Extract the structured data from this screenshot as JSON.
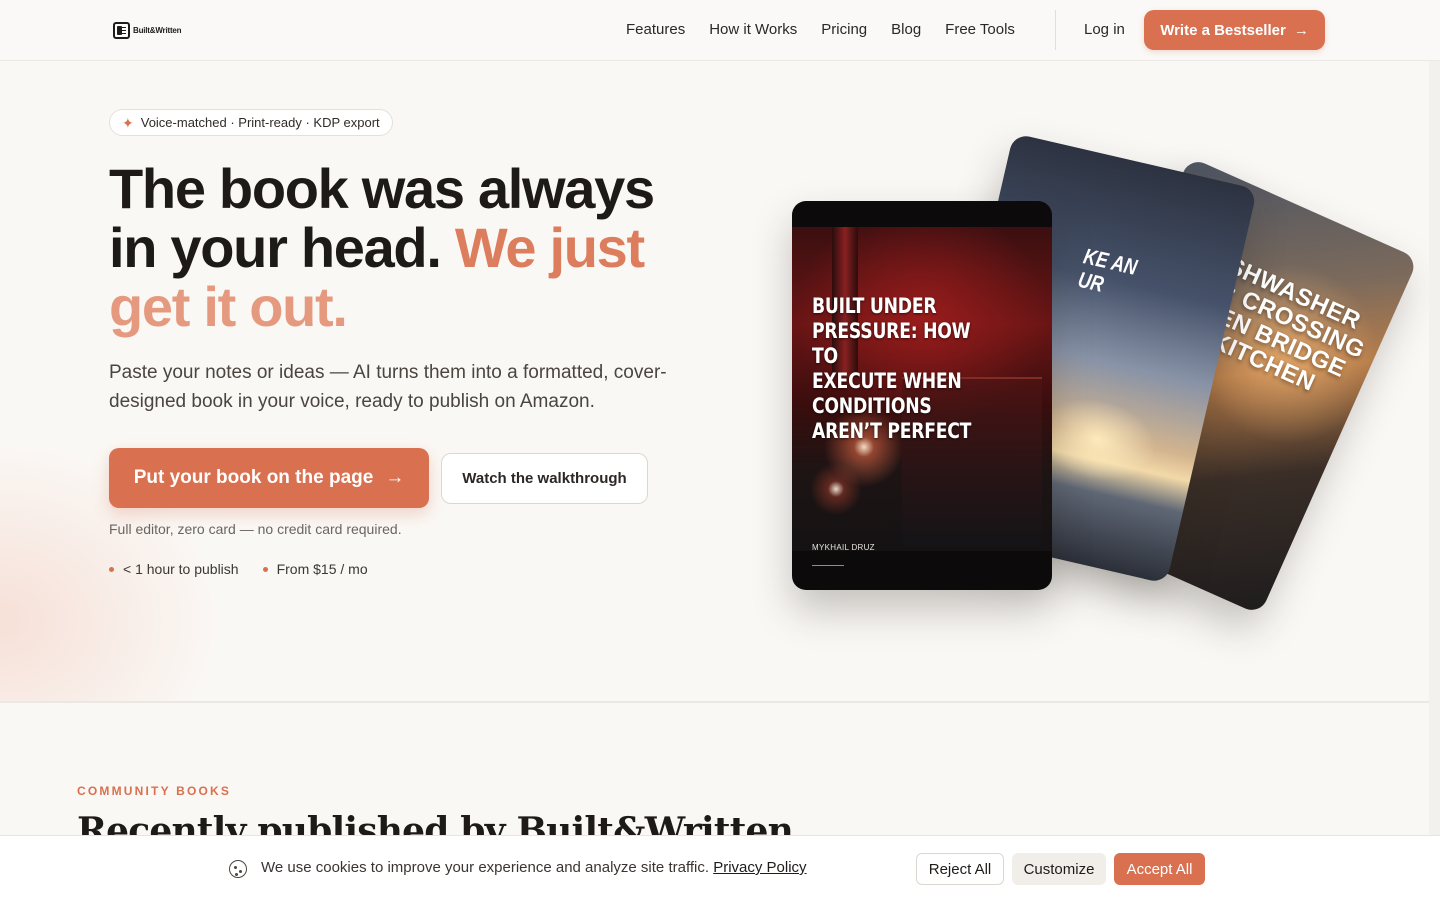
{
  "nav": {
    "logo_text": "Built&Written",
    "links": [
      "Features",
      "How it Works",
      "Pricing",
      "Blog",
      "Free Tools"
    ],
    "login": "Log in",
    "cta": "Write a Bestseller"
  },
  "hero": {
    "badge": "Voice-matched · Print-ready · KDP export",
    "headline_1": "The book was always in your head. ",
    "headline_accent_1": "We just",
    "headline_accent_2": "get it out.",
    "subhead": "Paste your notes or ideas — AI turns them into a formatted, cover-designed book in your voice, ready to publish on Amazon.",
    "primary_cta": "Put your book on the page",
    "secondary_cta": "Watch the walkthrough",
    "fineprint": "Full editor, zero card — no credit card required.",
    "facts": [
      "< 1 hour to publish",
      "From $15 / mo"
    ]
  },
  "books": {
    "front_title": "Built under pressure: How to\nexecute when conditions\naren’t perfect",
    "front_author": "MYKHAIL DRUZ",
    "mid_title_fragment": "KE AN\nUR",
    "back_title_fragment": "ISHWASHER\nK: CROSSING\nDEN BRIDGE\nY KITCHEN"
  },
  "community": {
    "label": "COMMUNITY BOOKS",
    "title": "Recently published by Built&Written"
  },
  "cookie": {
    "text": "We use cookies to improve your experience and analyze site traffic.",
    "link": "Privacy Policy",
    "reject": "Reject All",
    "customize": "Customize",
    "accept": "Accept All"
  },
  "colors": {
    "accent": "#d9704f",
    "background": "#faf8f5"
  }
}
